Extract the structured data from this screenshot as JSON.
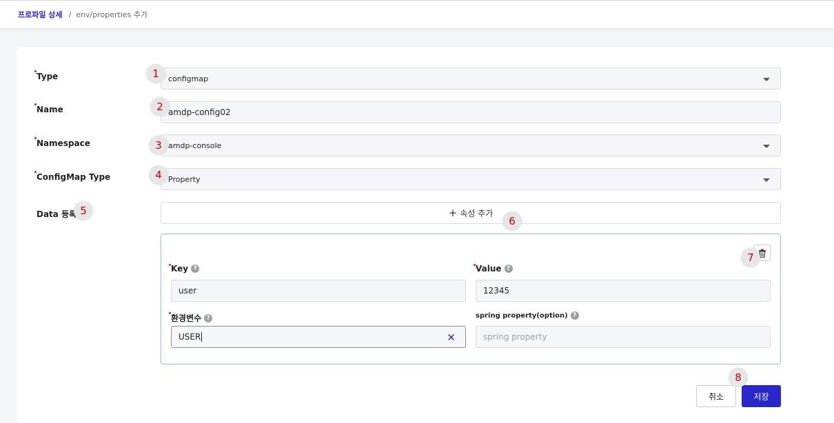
{
  "breadcrumb": {
    "parent": "프로파일 상세",
    "separator": "/",
    "current": "env/properties 추가"
  },
  "form": {
    "type": {
      "label": "Type",
      "value": "configmap"
    },
    "name": {
      "label": "Name",
      "value": "amdp-config02"
    },
    "namespace": {
      "label": "Namespace",
      "value": "amdp-console"
    },
    "configmap_type": {
      "label": "ConfigMap Type",
      "value": "Property"
    },
    "data_register": {
      "label": "Data 등록"
    },
    "add_attribute": {
      "icon": "plus-icon",
      "label": "속성 추가"
    }
  },
  "property": {
    "key": {
      "label": "Key",
      "value": "user"
    },
    "value": {
      "label": "Value",
      "value": "12345"
    },
    "env_var": {
      "label": "환경변수",
      "value": "USER"
    },
    "spring_property": {
      "label": "spring property(option)",
      "placeholder": "spring property"
    },
    "help_glyph": "?",
    "clear_glyph": "✕",
    "delete_icon": "trash-icon"
  },
  "actions": {
    "cancel": "취소",
    "save": "저장"
  },
  "markers": [
    "1",
    "2",
    "3",
    "4",
    "5",
    "6",
    "7",
    "8"
  ],
  "colors": {
    "accent": "#2a27c9",
    "required": "#d61f1f",
    "marker_text": "#c00000",
    "box_border": "#8ec3d8"
  }
}
